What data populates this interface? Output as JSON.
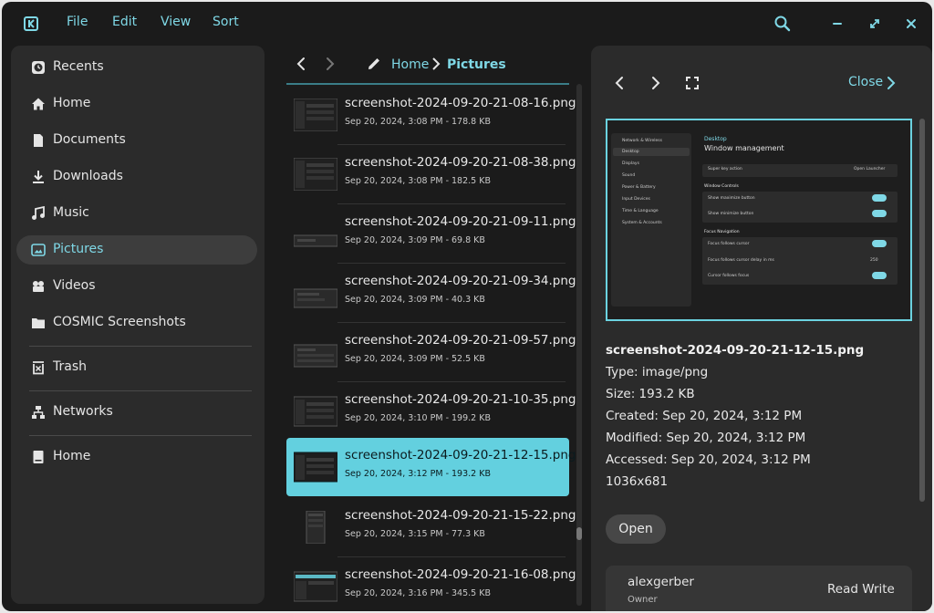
{
  "header": {
    "menus": [
      "File",
      "Edit",
      "View",
      "Sort"
    ],
    "icons": [
      "app-icon",
      "search-icon",
      "minimize-icon",
      "maximize-icon",
      "close-icon"
    ]
  },
  "sidebar": {
    "items": [
      {
        "label": "Recents",
        "icon": "clock-icon"
      },
      {
        "label": "Home",
        "icon": "home-icon"
      },
      {
        "label": "Documents",
        "icon": "document-icon"
      },
      {
        "label": "Downloads",
        "icon": "download-icon"
      },
      {
        "label": "Music",
        "icon": "music-icon"
      },
      {
        "label": "Pictures",
        "icon": "picture-icon",
        "active": true
      },
      {
        "label": "Videos",
        "icon": "video-icon"
      },
      {
        "label": "COSMIC Screenshots",
        "icon": "folder-icon"
      },
      {
        "label": "Trash",
        "icon": "trash-icon"
      },
      {
        "label": "Networks",
        "icon": "network-icon"
      },
      {
        "label": "Home",
        "icon": "drive-icon"
      }
    ]
  },
  "breadcrumb": {
    "parent": "Home",
    "current": "Pictures"
  },
  "files": [
    {
      "name": "screenshot-2024-09-20-21-08-16.png",
      "meta": "Sep 20, 2024, 3:08 PM - 178.8 KB"
    },
    {
      "name": "screenshot-2024-09-20-21-08-38.png",
      "meta": "Sep 20, 2024, 3:08 PM - 182.5 KB"
    },
    {
      "name": "screenshot-2024-09-20-21-09-11.png",
      "meta": "Sep 20, 2024, 3:09 PM - 69.8 KB"
    },
    {
      "name": "screenshot-2024-09-20-21-09-34.png",
      "meta": "Sep 20, 2024, 3:09 PM - 40.3 KB"
    },
    {
      "name": "screenshot-2024-09-20-21-09-57.png",
      "meta": "Sep 20, 2024, 3:09 PM - 52.5 KB"
    },
    {
      "name": "screenshot-2024-09-20-21-10-35.png",
      "meta": "Sep 20, 2024, 3:10 PM - 199.2 KB"
    },
    {
      "name": "screenshot-2024-09-20-21-12-15.png",
      "meta": "Sep 20, 2024, 3:12 PM - 193.2 KB",
      "selected": true
    },
    {
      "name": "screenshot-2024-09-20-21-15-22.png",
      "meta": "Sep 20, 2024, 3:15 PM - 77.3 KB"
    },
    {
      "name": "screenshot-2024-09-20-21-16-08.png",
      "meta": "Sep 20, 2024, 3:16 PM - 345.5 KB"
    }
  ],
  "details": {
    "close_label": "Close",
    "title": "screenshot-2024-09-20-21-12-15.png",
    "lines": [
      "Type: image/png",
      "Size: 193.2 KB",
      "Created: Sep 20, 2024, 3:12 PM",
      "Modified: Sep 20, 2024, 3:12 PM",
      "Accessed: Sep 20, 2024, 3:12 PM",
      "1036x681"
    ],
    "open_label": "Open",
    "permission": {
      "user": "alexgerber",
      "role": "Owner",
      "access": "Read Write"
    }
  },
  "preview": {
    "back_label": "Desktop",
    "title": "Window management",
    "nav": [
      "Network & Wireless",
      "Desktop",
      "Displays",
      "Sound",
      "Power & Battery",
      "Input Devices",
      "Time & Language",
      "System & Accounts"
    ],
    "super_key_label": "Super key action",
    "super_key_value": "Open Launcher",
    "section1": "Window Controls",
    "toggles1": [
      "Show maximize button",
      "Show minimize button"
    ],
    "section2": "Focus Navigation",
    "toggles2": [
      "Focus follows cursor",
      "Focus follows cursor delay in ms",
      "Cursor follows focus"
    ],
    "delay_value": "250"
  },
  "colors": {
    "accent": "#63d0df",
    "window": "#1b1b1b",
    "panel": "#2b2b2b"
  }
}
